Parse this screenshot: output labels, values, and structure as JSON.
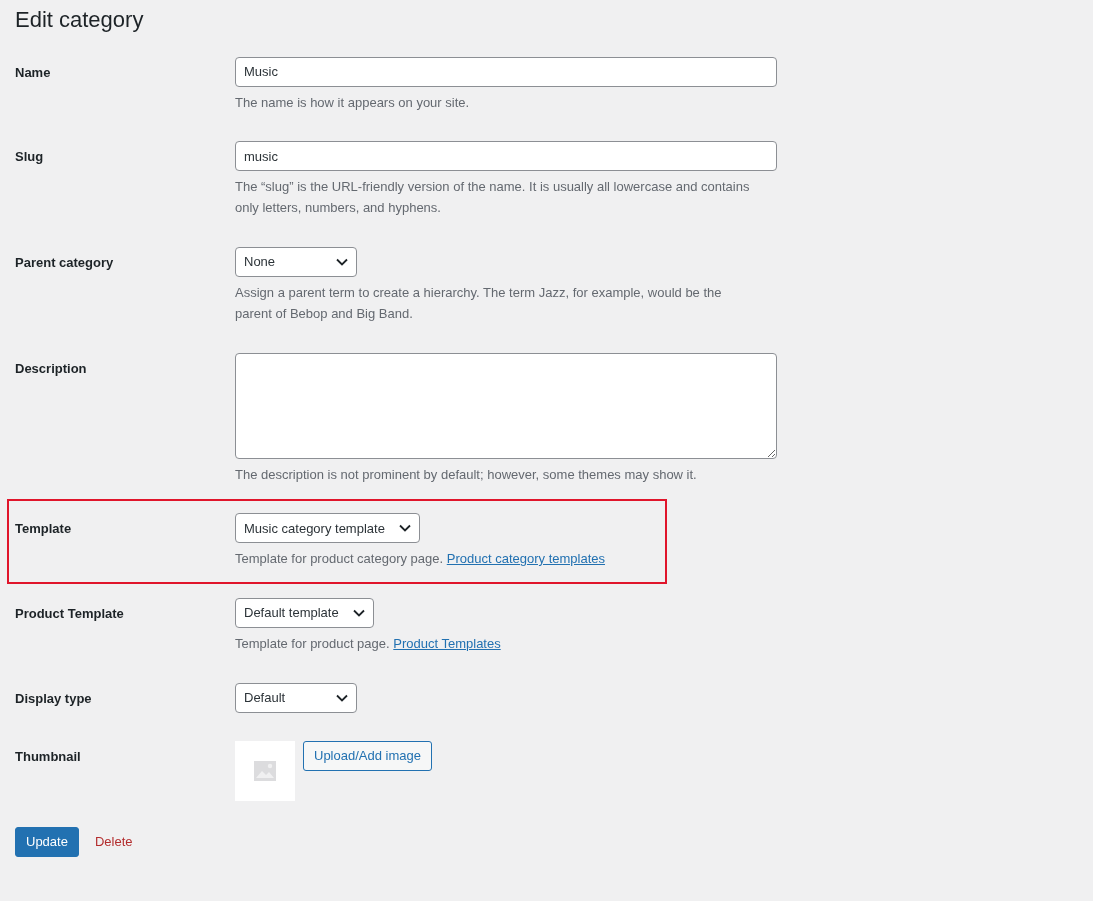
{
  "title": "Edit category",
  "fields": [
    {
      "kind": "text",
      "label": "Name",
      "value": "Music",
      "help": "The name is how it appears on your site.",
      "highlighted": false
    },
    {
      "kind": "text",
      "label": "Slug",
      "value": "music",
      "help": "The “slug” is the URL-friendly version of the name. It is usually all lowercase and contains only letters, numbers, and hyphens.",
      "highlighted": false
    },
    {
      "kind": "select",
      "label": "Parent category",
      "value": "None",
      "help": "Assign a parent term to create a hierarchy. The term Jazz, for example, would be the parent of Bebop and Big Band.",
      "highlighted": false
    },
    {
      "kind": "textarea",
      "label": "Description",
      "help": "The description is not prominent by default; however, some themes may show it.",
      "highlighted": false
    },
    {
      "kind": "select",
      "label": "Template",
      "value": "Music category template",
      "help": "Template for product category page.",
      "link": "Product category templates",
      "highlighted": true
    },
    {
      "kind": "select",
      "label": "Product Template",
      "value": "Default template",
      "help": "Template for product page.",
      "link": "Product Templates",
      "highlighted": false
    },
    {
      "kind": "select",
      "label": "Display type",
      "value": "Default",
      "highlighted": false
    },
    {
      "kind": "thumbnail",
      "label": "Thumbnail",
      "button": "Upload/Add image",
      "highlighted": false
    }
  ],
  "actions": {
    "primary": "Update",
    "delete": "Delete"
  }
}
